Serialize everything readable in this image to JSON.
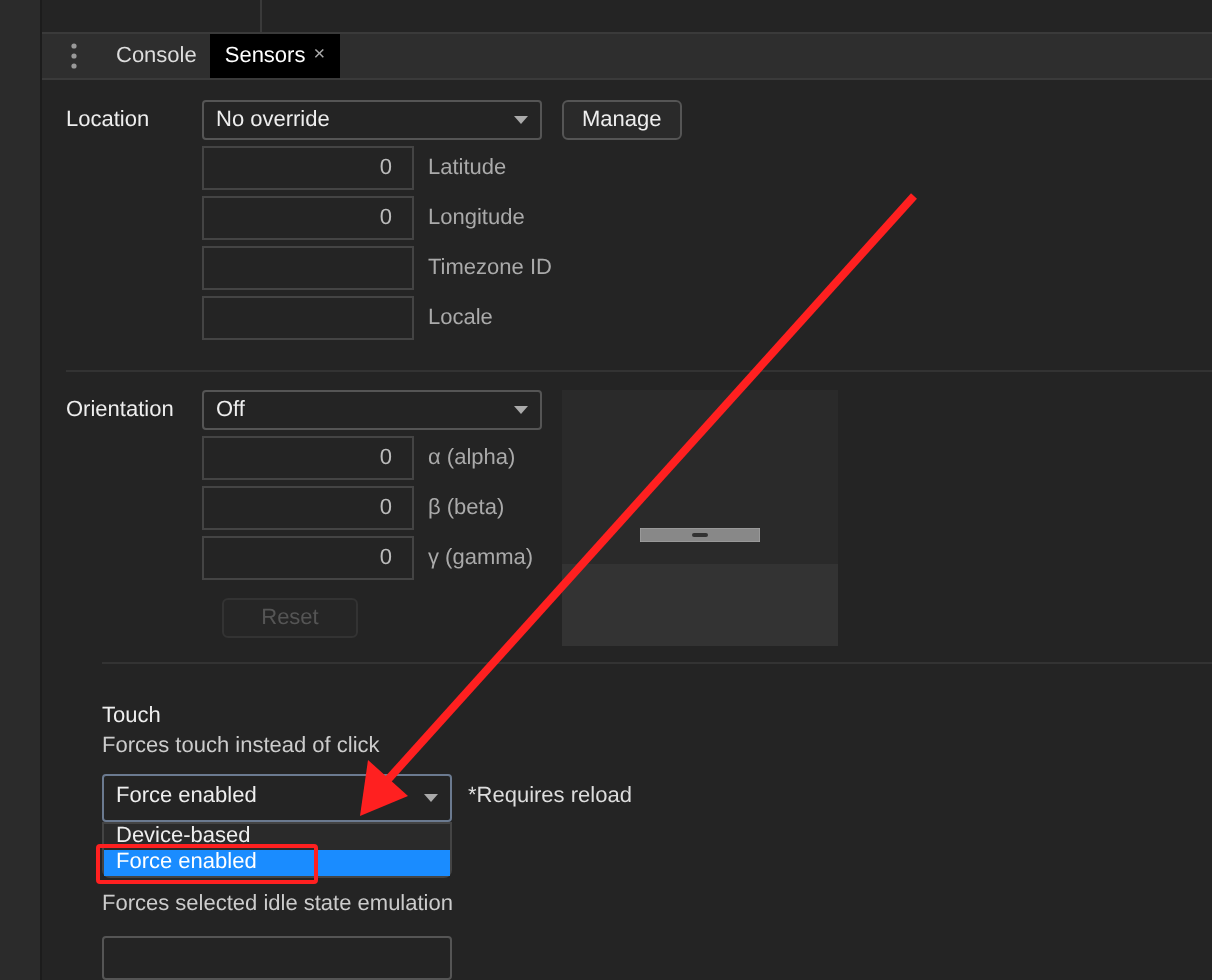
{
  "tabs": [
    {
      "label": "Console",
      "selected": false,
      "closable": false
    },
    {
      "label": "Sensors",
      "selected": true,
      "closable": true,
      "close_glyph": "×"
    }
  ],
  "location": {
    "label": "Location",
    "select": "No override",
    "button": "Manage",
    "fields": [
      {
        "value": "0",
        "label": "Latitude"
      },
      {
        "value": "0",
        "label": "Longitude"
      },
      {
        "label": "Timezone ID"
      },
      {
        "label": "Locale"
      }
    ]
  },
  "orientation": {
    "label": "Orientation",
    "select": "Off",
    "fields": [
      {
        "value": "0",
        "label": "α (alpha)"
      },
      {
        "value": "0",
        "label": "β (beta)"
      },
      {
        "value": "0",
        "label": "γ (gamma)"
      }
    ],
    "reset": {
      "label": "Reset",
      "disabled": true
    }
  },
  "touch": {
    "title": "Touch",
    "description": "Forces touch instead of click",
    "select": "Force enabled",
    "note": "*Requires reload",
    "dropdown_open": true,
    "options": [
      {
        "label": "Device-based",
        "selected": false
      },
      {
        "label": "Force enabled",
        "selected": true
      }
    ]
  },
  "idle": {
    "description": "Forces selected idle state emulation"
  }
}
